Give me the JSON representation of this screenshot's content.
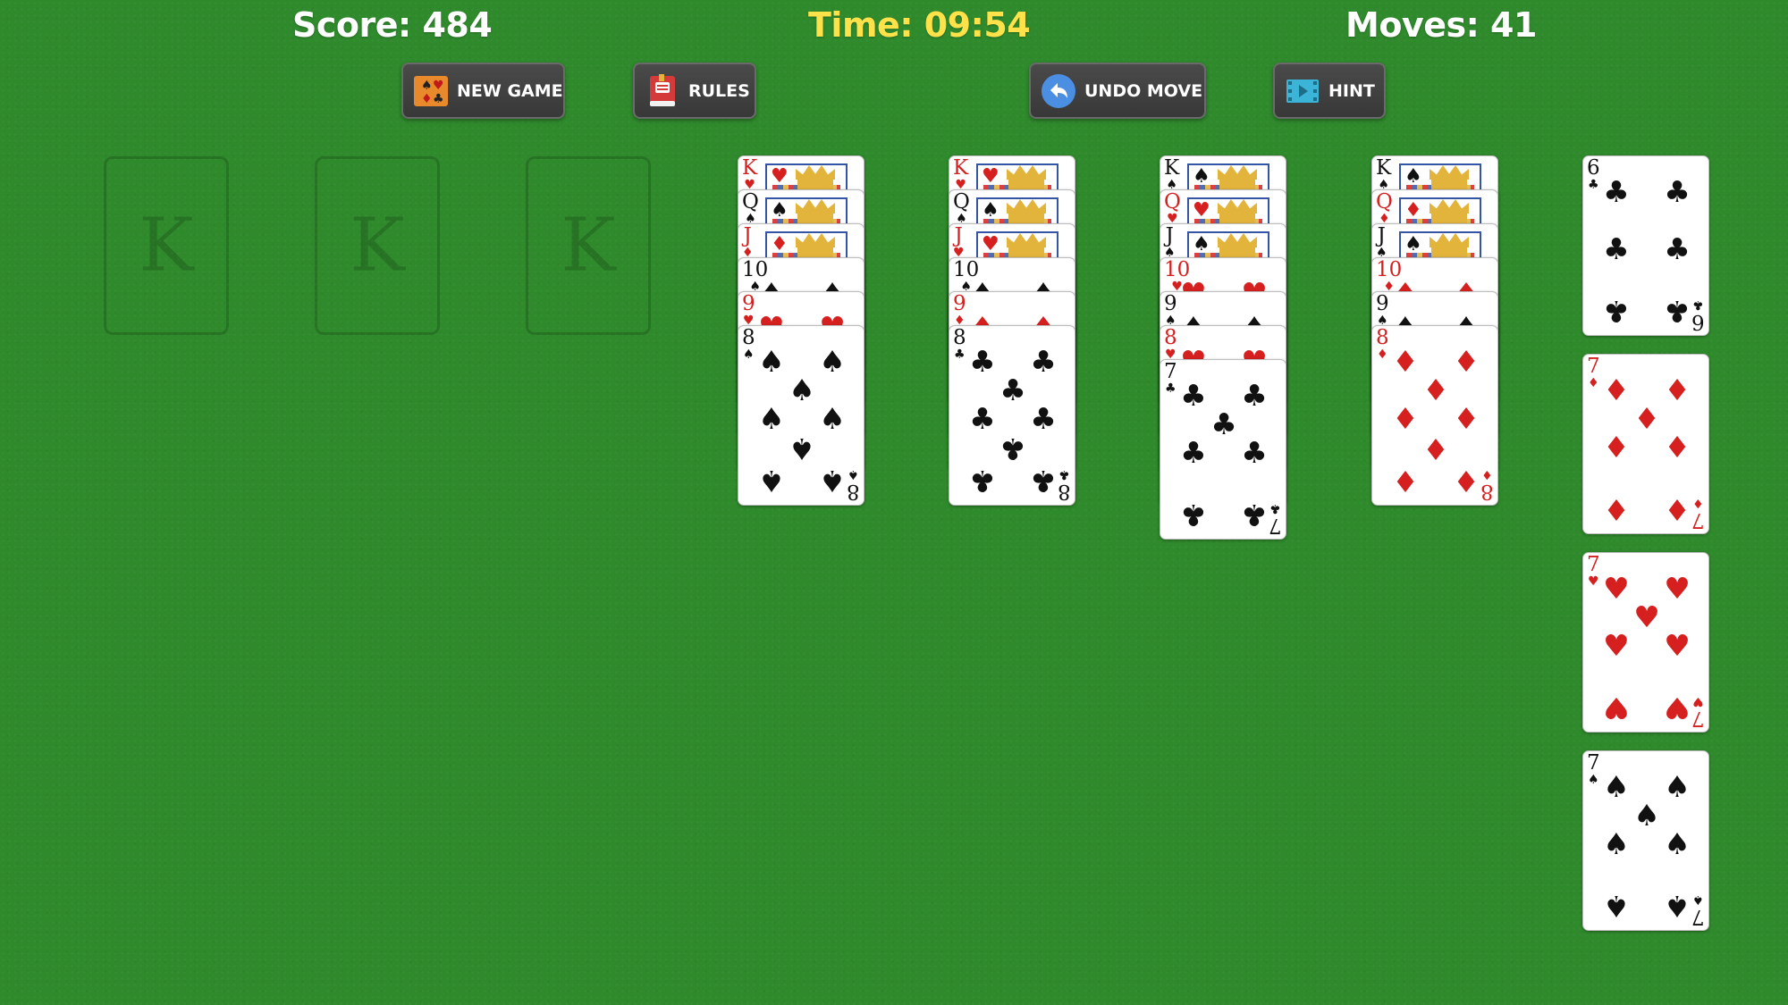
{
  "header": {
    "score_label": "Score: 484",
    "time_label": "Time: 09:54",
    "moves_label": "Moves: 41"
  },
  "toolbar": {
    "new_game_label": "NEW GAME",
    "rules_label": "RULES",
    "undo_label": "UNDO MOVE",
    "hint_label": "HINT"
  },
  "icons": {
    "new_game": "cards-icon",
    "rules": "book-icon",
    "undo": "undo-arrow-icon",
    "hint": "video-icon"
  },
  "colors": {
    "felt": "#2f8a2c",
    "score_text": "#ffffff",
    "time_text": "#ffe14a",
    "button_bg": "#3f3f3f",
    "red_suit": "#d5201f",
    "black_suit": "#111111"
  },
  "foundations": [
    {
      "label": "K"
    },
    {
      "label": "K"
    },
    {
      "label": "K"
    }
  ],
  "tableau": [
    {
      "cards": [
        {
          "rank": "K",
          "suit": "♥"
        },
        {
          "rank": "Q",
          "suit": "♠"
        },
        {
          "rank": "J",
          "suit": "♦"
        },
        {
          "rank": "10",
          "suit": "♠"
        },
        {
          "rank": "9",
          "suit": "♥"
        },
        {
          "rank": "8",
          "suit": "♠"
        }
      ]
    },
    {
      "cards": [
        {
          "rank": "K",
          "suit": "♥"
        },
        {
          "rank": "Q",
          "suit": "♠"
        },
        {
          "rank": "J",
          "suit": "♥"
        },
        {
          "rank": "10",
          "suit": "♠"
        },
        {
          "rank": "9",
          "suit": "♦"
        },
        {
          "rank": "8",
          "suit": "♣"
        }
      ]
    },
    {
      "cards": [
        {
          "rank": "K",
          "suit": "♠"
        },
        {
          "rank": "Q",
          "suit": "♥"
        },
        {
          "rank": "J",
          "suit": "♠"
        },
        {
          "rank": "10",
          "suit": "♥"
        },
        {
          "rank": "9",
          "suit": "♠"
        },
        {
          "rank": "8",
          "suit": "♥"
        },
        {
          "rank": "7",
          "suit": "♣"
        }
      ]
    },
    {
      "cards": [
        {
          "rank": "K",
          "suit": "♠"
        },
        {
          "rank": "Q",
          "suit": "♦"
        },
        {
          "rank": "J",
          "suit": "♠"
        },
        {
          "rank": "10",
          "suit": "♦"
        },
        {
          "rank": "9",
          "suit": "♠"
        },
        {
          "rank": "8",
          "suit": "♦"
        }
      ]
    }
  ],
  "right_column": [
    {
      "rank": "6",
      "suit": "♣"
    },
    {
      "rank": "7",
      "suit": "♦"
    },
    {
      "rank": "7",
      "suit": "♥"
    },
    {
      "rank": "7",
      "suit": "♠"
    }
  ]
}
